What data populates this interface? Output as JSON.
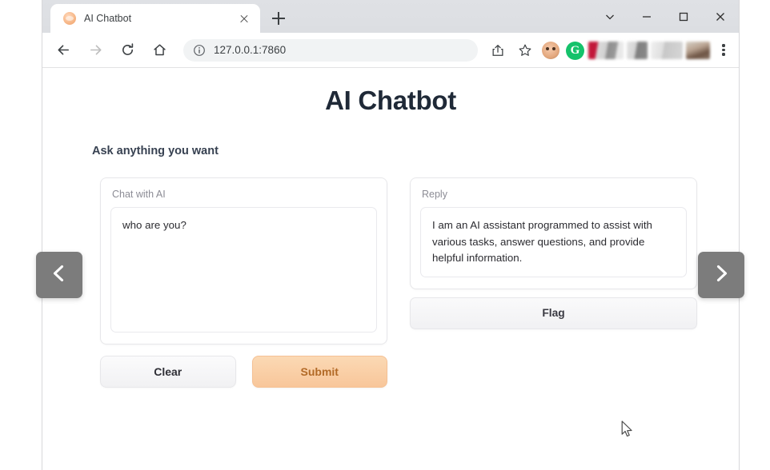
{
  "window": {
    "controls": [
      {
        "name": "chevron-down-icon",
        "label": "⌄"
      },
      {
        "name": "minimize-icon",
        "label": "—"
      },
      {
        "name": "maximize-icon",
        "label": "□"
      },
      {
        "name": "close-icon",
        "label": "✕"
      }
    ]
  },
  "tab": {
    "title": "AI Chatbot",
    "favicon": "gradio-favicon",
    "close_label": "",
    "new_tab_label": ""
  },
  "toolbar": {
    "back_icon": "back-arrow-icon",
    "forward_icon": "forward-arrow-icon",
    "reload_icon": "reload-icon",
    "home_icon": "home-icon",
    "url": "127.0.0.1:7860",
    "url_placeholder": "Search Google or type a URL",
    "site_info_icon": "info-circle-icon",
    "share_icon": "share-icon",
    "bookmark_icon": "star-icon",
    "profile_icon": "profile-avatar-icon",
    "grammarly_icon": "G",
    "menu_icon": "three-dot-menu-icon"
  },
  "page": {
    "title": "AI Chatbot",
    "subtitle": "Ask anything you want",
    "input_panel": {
      "label": "Chat with AI",
      "value": "who are you?",
      "placeholder": ""
    },
    "output_panel": {
      "label": "Reply",
      "value": "I am an AI assistant programmed to assist with various tasks, answer questions, and provide helpful information.",
      "flag_label": "Flag"
    },
    "buttons": {
      "clear_label": "Clear",
      "submit_label": "Submit"
    }
  },
  "carousel": {
    "prev_label": "‹",
    "next_label": "›"
  },
  "colors": {
    "submit_bg": "#f8c69a",
    "submit_text": "#b26a27",
    "arrow_bg": "#7c7c7c",
    "title_text": "#1f2937",
    "label_text": "#8c8c95"
  }
}
